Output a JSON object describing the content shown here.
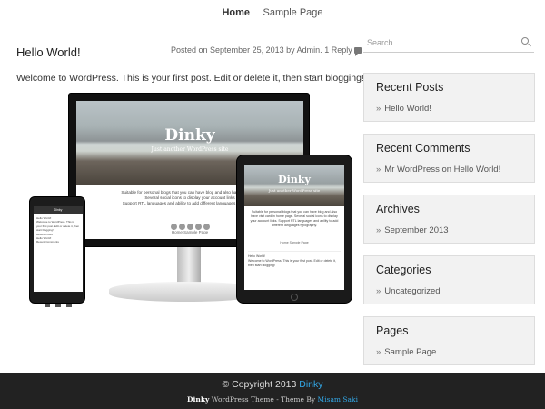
{
  "nav": {
    "items": [
      "Home",
      "Sample Page"
    ]
  },
  "post": {
    "title": "Hello World!",
    "meta_prefix": "Posted on",
    "date": "September 25, 2013",
    "meta_by": "by",
    "author": "Admin.",
    "reply": "1 Reply",
    "body": "Welcome to WordPress. This is your first post. Edit or delete it, then start blogging!"
  },
  "illustration": {
    "site_title": "Dinky",
    "tagline": "Just another WordPress site",
    "desc_lines": [
      "Suitable for personal blogs that you can have blog and also have visit card",
      "Several social icons to display your account links",
      "Support RTL languages and ability to add different languages typography"
    ],
    "tablet_desc": "Suitable for personal blogs that you can have blog and also have visit card in home page. Several social icons to display your account links. Support RTL languages and ability to add different languages typography.",
    "mini_nav": "Home     Sample Page",
    "tablet_post_title": "Hello World!",
    "tablet_post_body": "Welcome to WordPress. This is your first post. Edit or delete it, then start blogging!",
    "phone_bar": "Dinky",
    "phone_lines": [
      "Hello World!",
      "Welcome to WordPress. This is your first post. Edit or delete it, then start blogging!",
      "Recent Posts",
      "Hello World!",
      "Recent Comments"
    ]
  },
  "search": {
    "placeholder": "Search..."
  },
  "widgets": [
    {
      "title": "Recent Posts",
      "item": "Hello World!"
    },
    {
      "title": "Recent Comments",
      "item": "Mr WordPress on Hello World!"
    },
    {
      "title": "Archives",
      "item": "September 2013"
    },
    {
      "title": "Categories",
      "item": "Uncategorized"
    },
    {
      "title": "Pages",
      "item": "Sample Page"
    }
  ],
  "footer": {
    "copyright": "© Copyright 2013",
    "site_link": "Dinky",
    "theme_name": "Dinky",
    "theme_text": "WordPress Theme - Theme By",
    "author_link": "Misam Saki"
  },
  "colors": {
    "link": "#33a7e6",
    "footer_bg": "#222222",
    "widget_bg": "#f2f2f2"
  }
}
